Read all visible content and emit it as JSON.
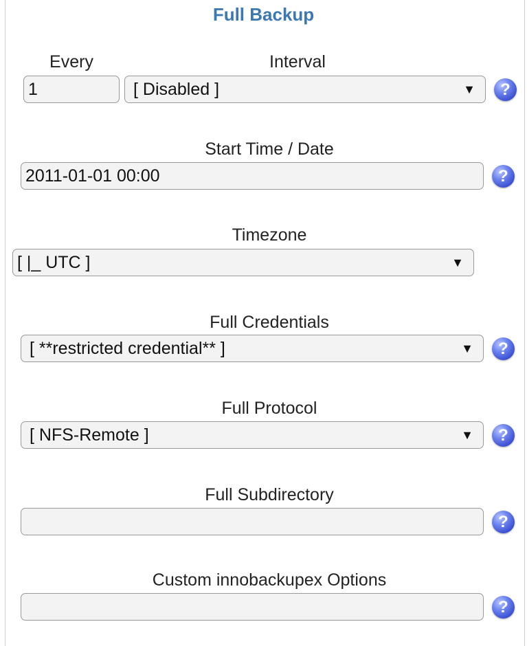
{
  "title": "Full Backup",
  "every": {
    "label": "Every",
    "value": "1"
  },
  "interval": {
    "label": "Interval",
    "value": "[ Disabled ]"
  },
  "start_time": {
    "label": "Start Time / Date",
    "value": "2011-01-01 00:00"
  },
  "timezone": {
    "label": "Timezone",
    "value": "[ |_ UTC ]"
  },
  "credentials": {
    "label": "Full Credentials",
    "value": "[ **restricted credential** ]"
  },
  "protocol": {
    "label": "Full Protocol",
    "value": "[ NFS-Remote ]"
  },
  "subdirectory": {
    "label": "Full Subdirectory",
    "value": ""
  },
  "custom_options": {
    "label": "Custom innobackupex Options",
    "value": ""
  },
  "icons": {
    "help_glyph": "?",
    "caret_glyph": "▼",
    "help_icon": "question-circle-icon",
    "caret_icon": "caret-down-icon"
  },
  "colors": {
    "title": "#3c78b4",
    "help_icon": "#3a4fd0",
    "field_bg": "#f3f3f3",
    "field_border": "#9a9a9a"
  }
}
